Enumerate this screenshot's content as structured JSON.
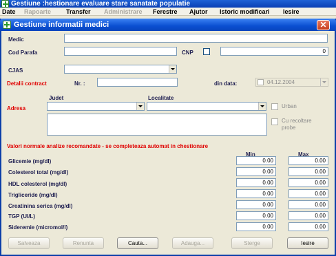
{
  "app": {
    "title": "Gestiune :hestionare evaluare stare sanatate populatie"
  },
  "menu": [
    {
      "label": "Date",
      "enabled": true
    },
    {
      "label": "Rapoarte",
      "enabled": false
    },
    {
      "label": "Transfer",
      "enabled": true
    },
    {
      "label": "Administrare",
      "enabled": false
    },
    {
      "label": "Ferestre",
      "enabled": true
    },
    {
      "label": "Ajutor",
      "enabled": true
    },
    {
      "label": "Istoric modificari",
      "enabled": true
    },
    {
      "label": "Iesire",
      "enabled": true
    }
  ],
  "dialog": {
    "title": "Gestiune informatii medici",
    "close_symbol": "✕"
  },
  "form": {
    "medic_label": "Medic",
    "medic_value": "",
    "cod_parafa_label": "Cod Parafa",
    "cod_parafa_value": "",
    "cnp_label": "CNP",
    "cnp_value": "0",
    "cjas_label": "CJAS",
    "cjas_value": "",
    "detalii_label": "Detalii contract",
    "nr_label": "Nr. :",
    "nr_value": "",
    "din_data_label": "din data:",
    "din_data_value": "04.12.2004",
    "adresa_label": "Adresa",
    "judet_label": "Judet",
    "judet_value": "",
    "localitate_label": "Localitate",
    "localitate_value": "",
    "urban_label": "Urban",
    "recoltare_label_1": "Cu recoltare",
    "recoltare_label_2": "probe",
    "adresa_detalii": ""
  },
  "analize": {
    "heading": "Valori normale analize recomandate - se completeaza automat in chestionare",
    "min_header": "Min",
    "max_header": "Max",
    "rows": [
      {
        "label": "Glicemie (mg/dl)",
        "min": "0.00",
        "max": "0.00"
      },
      {
        "label": "Colesterol total (mg/dl)",
        "min": "0.00",
        "max": "0.00"
      },
      {
        "label": "HDL colesterol (mg/dl)",
        "min": "0.00",
        "max": "0.00"
      },
      {
        "label": "Trigliceride (mg/dl)",
        "min": "0.00",
        "max": "0.00"
      },
      {
        "label": "Creatinina serica (mg/dl)",
        "min": "0.00",
        "max": "0.00"
      },
      {
        "label": "TGP (UI/L)",
        "min": "0.00",
        "max": "0.00"
      },
      {
        "label": "Sideremie (micromol/l)",
        "min": "0.00",
        "max": "0.00"
      }
    ]
  },
  "buttons": [
    {
      "label": "Salveaza",
      "enabled": false
    },
    {
      "label": "Renunta",
      "enabled": false
    },
    {
      "label": "Cauta...",
      "enabled": true
    },
    {
      "label": "Adauga...",
      "enabled": false
    },
    {
      "label": "Sterge",
      "enabled": false
    },
    {
      "label": "Iesire",
      "enabled": true
    }
  ]
}
